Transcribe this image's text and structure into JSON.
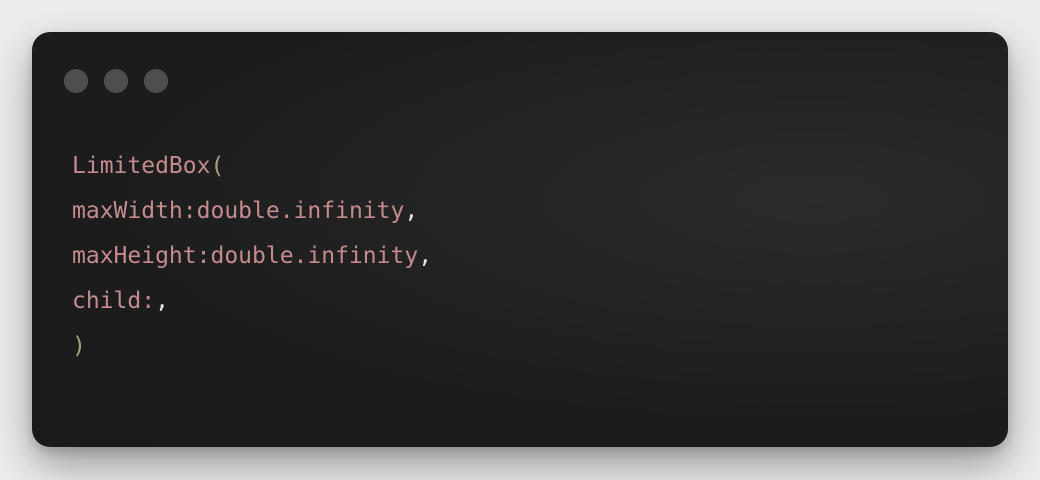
{
  "window": {
    "controls": [
      "close-dot",
      "minimize-dot",
      "maximize-dot"
    ],
    "colors": {
      "background": "#1c1c1c",
      "dot": "#4e4e4e",
      "identifier": "#c48b8e",
      "paren": "#a3a27a",
      "punctuation": "#e6e6e6"
    }
  },
  "code": {
    "line1": {
      "name": "LimitedBox",
      "open": "("
    },
    "line2": {
      "text": "maxWidth:double.infinity",
      "comma": ","
    },
    "line3": {
      "text": "maxHeight:double.infinity",
      "comma": ","
    },
    "line4": {
      "text": "child:",
      "comma": ","
    },
    "line5": {
      "close": ")"
    }
  }
}
